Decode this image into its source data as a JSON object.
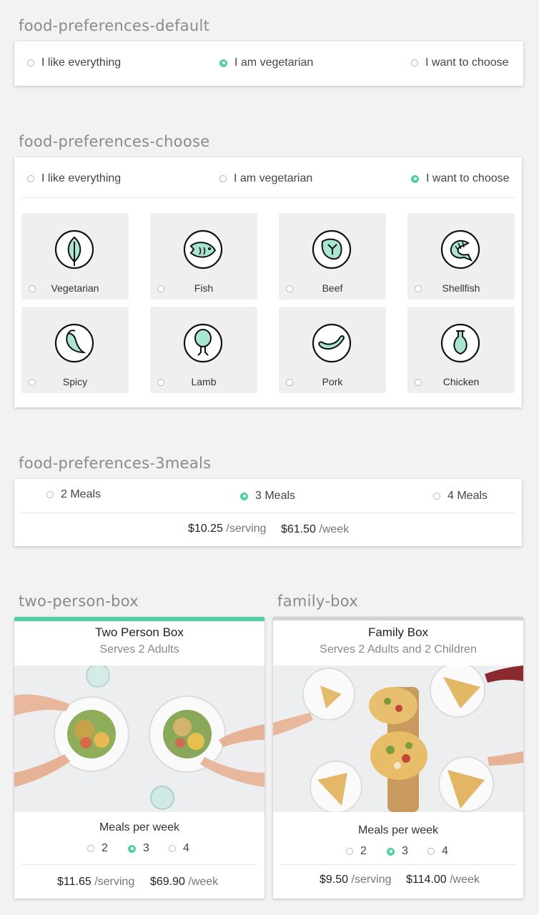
{
  "sections": {
    "default_title": "food-preferences-default",
    "choose_title": "food-preferences-choose",
    "meals_title": "food-preferences-3meals",
    "two_person_title": "two-person-box",
    "family_title": "family-box"
  },
  "preferences": {
    "like_everything": "I like everything",
    "vegetarian": "I am vegetarian",
    "choose": "I want to choose"
  },
  "tiles": [
    {
      "label": "Vegetarian",
      "icon": "leaf-icon"
    },
    {
      "label": "Fish",
      "icon": "fish-icon"
    },
    {
      "label": "Beef",
      "icon": "steak-icon"
    },
    {
      "label": "Shellfish",
      "icon": "shrimp-icon"
    },
    {
      "label": "Spicy",
      "icon": "chili-icon"
    },
    {
      "label": "Lamb",
      "icon": "drumstick-icon"
    },
    {
      "label": "Pork",
      "icon": "sausage-icon"
    },
    {
      "label": "Chicken",
      "icon": "chicken-leg-icon"
    }
  ],
  "meals": {
    "options": [
      "2 Meals",
      "3 Meals",
      "4 Meals"
    ],
    "selected": "3 Meals",
    "serving_price": "$10.25",
    "serving_unit": "/serving",
    "week_price": "$61.50",
    "week_unit": "/week"
  },
  "two_person": {
    "title": "Two Person Box",
    "subtitle": "Serves 2 Adults",
    "meals_label": "Meals per week",
    "options": [
      "2",
      "3",
      "4"
    ],
    "selected": "3",
    "serving_price": "$11.65",
    "serving_unit": "/serving",
    "week_price": "$69.90",
    "week_unit": "/week",
    "accent": "#4fd1a5"
  },
  "family": {
    "title": "Family Box",
    "subtitle": "Serves 2  Adults and 2 Children",
    "meals_label": "Meals per week",
    "options": [
      "2",
      "3",
      "4"
    ],
    "selected": "3",
    "serving_price": "$9.50",
    "serving_unit": "/serving",
    "week_price": "$114.00",
    "week_unit": "/week"
  },
  "colors": {
    "accent": "#4fd1a5",
    "icon_fill": "#a8e6cf"
  }
}
